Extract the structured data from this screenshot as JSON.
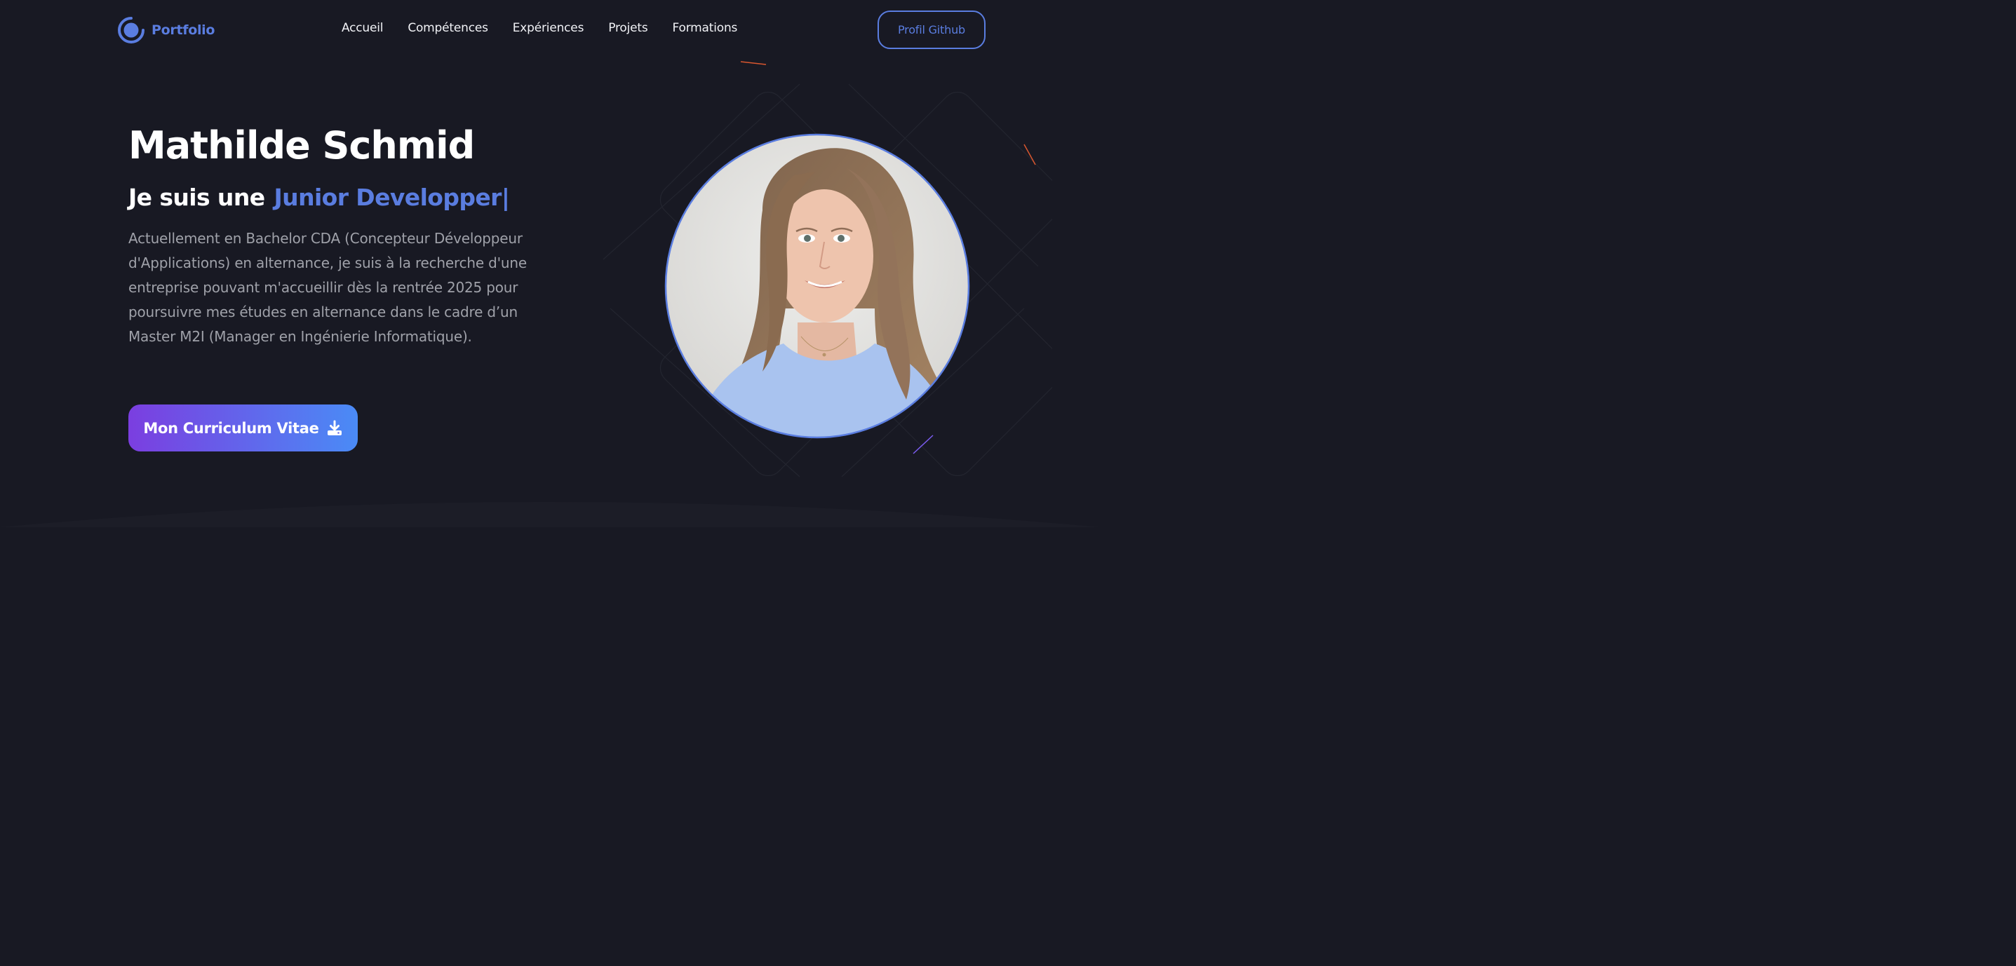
{
  "brand": {
    "name": "Portfolio",
    "icon": "logo-ring-icon",
    "accent_color": "#5a7de0"
  },
  "nav": {
    "links": [
      {
        "label": "Accueil"
      },
      {
        "label": "Compétences"
      },
      {
        "label": "Expériences"
      },
      {
        "label": "Projets"
      },
      {
        "label": "Formations"
      }
    ],
    "github_button": "Profil Github"
  },
  "hero": {
    "name": "Mathilde Schmid",
    "role_prefix": "Je suis une",
    "role_typed": "Junior Developper",
    "cursor": "|",
    "description": "Actuellement en Bachelor CDA (Concepteur Développeur d'Applications) en alternance, je suis à la recherche d'une entreprise pouvant m'accueillir dès la rentrée 2025 pour poursuivre mes études en alternance dans le cadre d’un Master M2I (Manager en Ingénierie Informatique).",
    "cv_button": "Mon Curriculum Vitae",
    "cv_icon": "download-icon",
    "cv_gradient": [
      "#7b3ee0",
      "#4a8bf6"
    ]
  },
  "portrait": {
    "alt": "Photo de Mathilde Schmid",
    "border_color": "#5a7de0"
  },
  "colors": {
    "background": "#181923",
    "text": "#ffffff",
    "muted": "#9fa1a9"
  }
}
